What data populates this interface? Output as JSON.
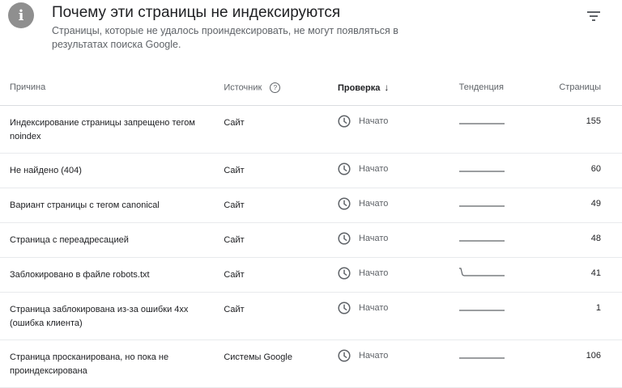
{
  "header": {
    "info_icon": "i",
    "title": "Почему эти страницы не индексируются",
    "subtitle": "Страницы, которые не удалось проиндексировать, не могут появляться в результатах поиска Google."
  },
  "table": {
    "columns": {
      "reason": "Причина",
      "source": "Источник",
      "check": "Проверка",
      "trend": "Тенденция",
      "pages": "Страницы"
    },
    "help_icon": "?",
    "sort_arrow": "↓",
    "rows": [
      {
        "reason": "Индексирование страницы запрещено тегом noindex",
        "source": "Сайт",
        "status": "Начато",
        "pages": "155",
        "trend_shape": "flat"
      },
      {
        "reason": "Не найдено (404)",
        "source": "Сайт",
        "status": "Начато",
        "pages": "60",
        "trend_shape": "flat"
      },
      {
        "reason": "Вариант страницы с тегом canonical",
        "source": "Сайт",
        "status": "Начато",
        "pages": "49",
        "trend_shape": "flat"
      },
      {
        "reason": "Страница с переадресацией",
        "source": "Сайт",
        "status": "Начато",
        "pages": "48",
        "trend_shape": "flat"
      },
      {
        "reason": "Заблокировано в файле robots.txt",
        "source": "Сайт",
        "status": "Начато",
        "pages": "41",
        "trend_shape": "drop"
      },
      {
        "reason": "Страница заблокирована из-за ошибки 4xx (ошибка клиента)",
        "source": "Сайт",
        "status": "Начато",
        "pages": "1",
        "trend_shape": "flat"
      },
      {
        "reason": "Страница просканирована, но пока не проиндексирована",
        "source": "Системы Google",
        "status": "Начато",
        "pages": "106",
        "trend_shape": "flat"
      }
    ]
  },
  "icons": {
    "info": "info-icon",
    "filter": "filter-icon",
    "help": "help-icon",
    "clock": "clock-icon"
  }
}
